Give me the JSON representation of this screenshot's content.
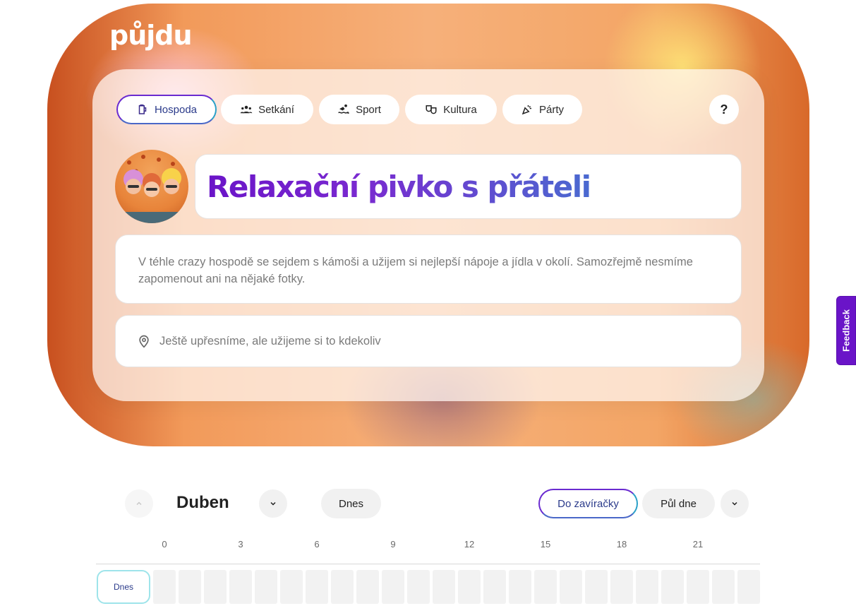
{
  "brand": {
    "logo": "půjdu"
  },
  "categories": [
    {
      "label": "Hospoda",
      "icon": "beer-mug-icon",
      "active": true
    },
    {
      "label": "Setkání",
      "icon": "group-icon",
      "active": false
    },
    {
      "label": "Sport",
      "icon": "swimmer-icon",
      "active": false
    },
    {
      "label": "Kultura",
      "icon": "theater-masks-icon",
      "active": false
    },
    {
      "label": "Párty",
      "icon": "party-popper-icon",
      "active": false
    }
  ],
  "help": {
    "label": "?"
  },
  "event": {
    "title": "Relaxační pivko s přáteli",
    "description": "V téhle crazy hospodě se sejdem s kámoši a užijem si nejlepší nápoje a jídla v okolí. Samozřejmě nesmíme zapomenout ani na nějaké fotky.",
    "location": "Ještě upřesníme, ale užijeme si to kdekoliv"
  },
  "feedback": {
    "label": "Feedback"
  },
  "calendar": {
    "month": "Duben",
    "today_button": "Dnes",
    "until_close": "Do zavíračky",
    "half_day": "Půl dne",
    "hours": [
      "0",
      "3",
      "6",
      "9",
      "12",
      "15",
      "18",
      "21"
    ],
    "row_label": "Dnes"
  },
  "colors": {
    "accent": "#6a14c8",
    "accent_secondary": "#2aa0c8"
  }
}
